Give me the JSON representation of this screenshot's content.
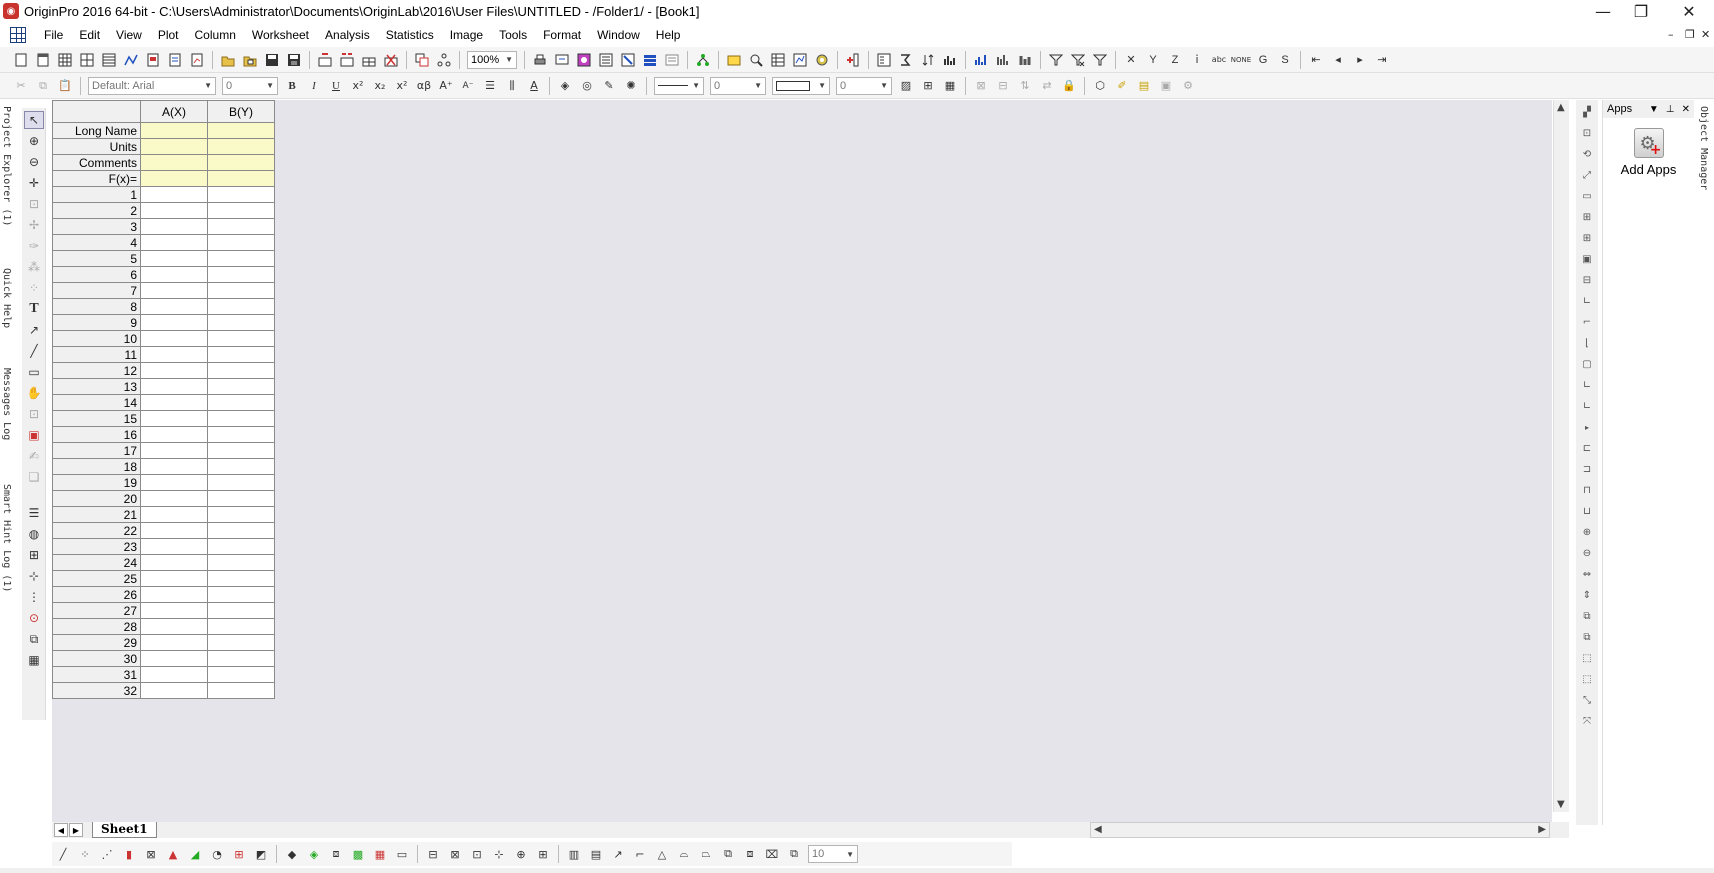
{
  "window": {
    "title": "OriginPro 2016 64-bit - C:\\Users\\Administrator\\Documents\\OriginLab\\2016\\User Files\\UNTITLED - /Folder1/ - [Book1]",
    "app_icon_glyph": "◉",
    "minimize": "—",
    "maximize": "❐",
    "close": "✕"
  },
  "menubar": {
    "items": [
      "File",
      "Edit",
      "View",
      "Plot",
      "Column",
      "Worksheet",
      "Analysis",
      "Statistics",
      "Image",
      "Tools",
      "Format",
      "Window",
      "Help"
    ],
    "mdi_minimize": "–",
    "mdi_restore": "❐",
    "mdi_close": "✕"
  },
  "toolbar1": {
    "zoom_value": "100%"
  },
  "toolbar2": {
    "font_value": "Default: Arial",
    "font_size_value": "0",
    "line_width_value": "0",
    "border_value": "0"
  },
  "left_dock": {
    "tabs": [
      "Project Explorer (1)",
      "Quick Help",
      "Messages Log",
      "Smart Hint Log (1)"
    ]
  },
  "worksheet": {
    "columns": [
      "A(X)",
      "B(Y)"
    ],
    "meta_rows": [
      "Long Name",
      "Units",
      "Comments",
      "F(x)="
    ],
    "row_numbers": [
      "1",
      "2",
      "3",
      "4",
      "5",
      "6",
      "7",
      "8",
      "9",
      "10",
      "11",
      "12",
      "13",
      "14",
      "15",
      "16",
      "17",
      "18",
      "19",
      "20",
      "21",
      "22",
      "23",
      "24",
      "25",
      "26",
      "27",
      "28",
      "29",
      "30",
      "31",
      "32"
    ]
  },
  "sheet": {
    "tab_label": "Sheet1"
  },
  "apps_panel": {
    "title": "Apps",
    "add_apps_label": "Add Apps"
  },
  "right_dock": {
    "object_manager_tab": "Object Manager"
  },
  "bottom_toolbar": {
    "size_value": "10"
  },
  "icons": [
    "new-project-icon",
    "open-icon",
    "save-icon",
    "print-icon",
    "bold-icon",
    "italic-icon",
    "underline-icon",
    "pointer-icon",
    "zoom-in-icon",
    "zoom-out-icon",
    "text-tool-icon",
    "arrow-tool-icon",
    "line-tool-icon",
    "rectangle-tool-icon",
    "hand-tool-icon",
    "gear-icon",
    "plus-icon"
  ]
}
